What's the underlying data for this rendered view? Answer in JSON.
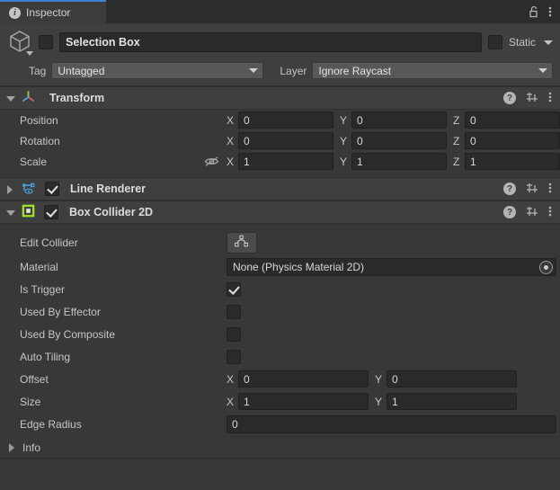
{
  "window": {
    "tab_label": "Inspector",
    "tab_icon": "info-icon",
    "lock_icon": "padlock-unlocked-icon",
    "menu_icon": "kebab-menu-icon"
  },
  "gameobject": {
    "icon": "cube-gameobject-icon",
    "active_checked": false,
    "name": "Selection Box",
    "static_label": "Static",
    "static_checked": false,
    "tag_label": "Tag",
    "tag_value": "Untagged",
    "layer_label": "Layer",
    "layer_value": "Ignore Raycast"
  },
  "components": [
    {
      "name": "Transform",
      "icon": "transform-axes-icon",
      "expanded": true,
      "has_enable_checkbox": false,
      "rows": [
        {
          "label": "Position",
          "axes": [
            {
              "axis": "X",
              "value": "0"
            },
            {
              "axis": "Y",
              "value": "0"
            },
            {
              "axis": "Z",
              "value": "0"
            }
          ]
        },
        {
          "label": "Rotation",
          "axes": [
            {
              "axis": "X",
              "value": "0"
            },
            {
              "axis": "Y",
              "value": "0"
            },
            {
              "axis": "Z",
              "value": "0"
            }
          ]
        },
        {
          "label": "Scale",
          "lock_icon": "constrained-proportions-off-icon",
          "axes": [
            {
              "axis": "X",
              "value": "1"
            },
            {
              "axis": "Y",
              "value": "1"
            },
            {
              "axis": "Z",
              "value": "1"
            }
          ]
        }
      ]
    },
    {
      "name": "Line Renderer",
      "icon": "line-renderer-icon",
      "expanded": false,
      "has_enable_checkbox": true,
      "enabled": true
    },
    {
      "name": "Box Collider 2D",
      "icon": "box-collider-2d-icon",
      "expanded": true,
      "has_enable_checkbox": true,
      "enabled": true
    }
  ],
  "box_collider": {
    "edit_collider_label": "Edit Collider",
    "edit_collider_icon": "polygon-edit-icon",
    "material_label": "Material",
    "material_value": "None (Physics Material 2D)",
    "material_picker_icon": "object-picker-icon",
    "is_trigger_label": "Is Trigger",
    "is_trigger_checked": true,
    "used_by_effector_label": "Used By Effector",
    "used_by_effector_checked": false,
    "used_by_composite_label": "Used By Composite",
    "used_by_composite_checked": false,
    "auto_tiling_label": "Auto Tiling",
    "auto_tiling_checked": false,
    "offset_label": "Offset",
    "offset_x_axis": "X",
    "offset_x": "0",
    "offset_y_axis": "Y",
    "offset_y": "0",
    "size_label": "Size",
    "size_x_axis": "X",
    "size_x": "1",
    "size_y_axis": "Y",
    "size_y": "1",
    "edge_radius_label": "Edge Radius",
    "edge_radius_value": "0",
    "info_label": "Info"
  },
  "component_header_icons": {
    "help": "help-icon",
    "preset": "preset-settings-icon",
    "menu": "kebab-menu-icon"
  },
  "colors": {
    "accent_tab": "#3f7fd4",
    "panel_bg": "#383838",
    "header_bg": "#3f3f3f",
    "field_bg": "#2a2a2a",
    "dropdown_bg": "#585858",
    "collider_green": "#a2e32a",
    "line_renderer_blue": "#4aa3e0"
  }
}
